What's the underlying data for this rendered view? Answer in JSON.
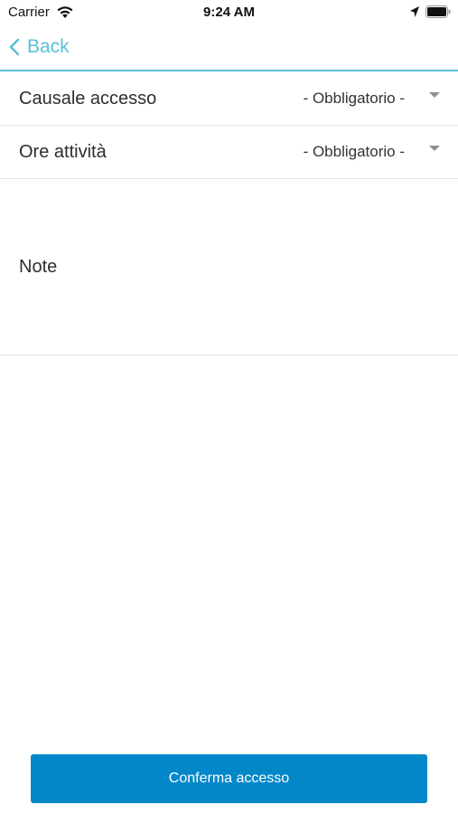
{
  "status_bar": {
    "carrier": "Carrier",
    "time": "9:24 AM",
    "icons": [
      "wifi-icon",
      "location-arrow-icon",
      "battery-icon"
    ]
  },
  "nav": {
    "back_label": "Back",
    "accent_color": "#5bbfd7"
  },
  "form": {
    "causale": {
      "label": "Causale accesso",
      "value": "- Obbligatorio -"
    },
    "ore": {
      "label": "Ore attività",
      "value": "- Obbligatorio -"
    },
    "note": {
      "label": "Note"
    }
  },
  "confirm": {
    "label": "Conferma accesso",
    "color": "#0287c9"
  }
}
